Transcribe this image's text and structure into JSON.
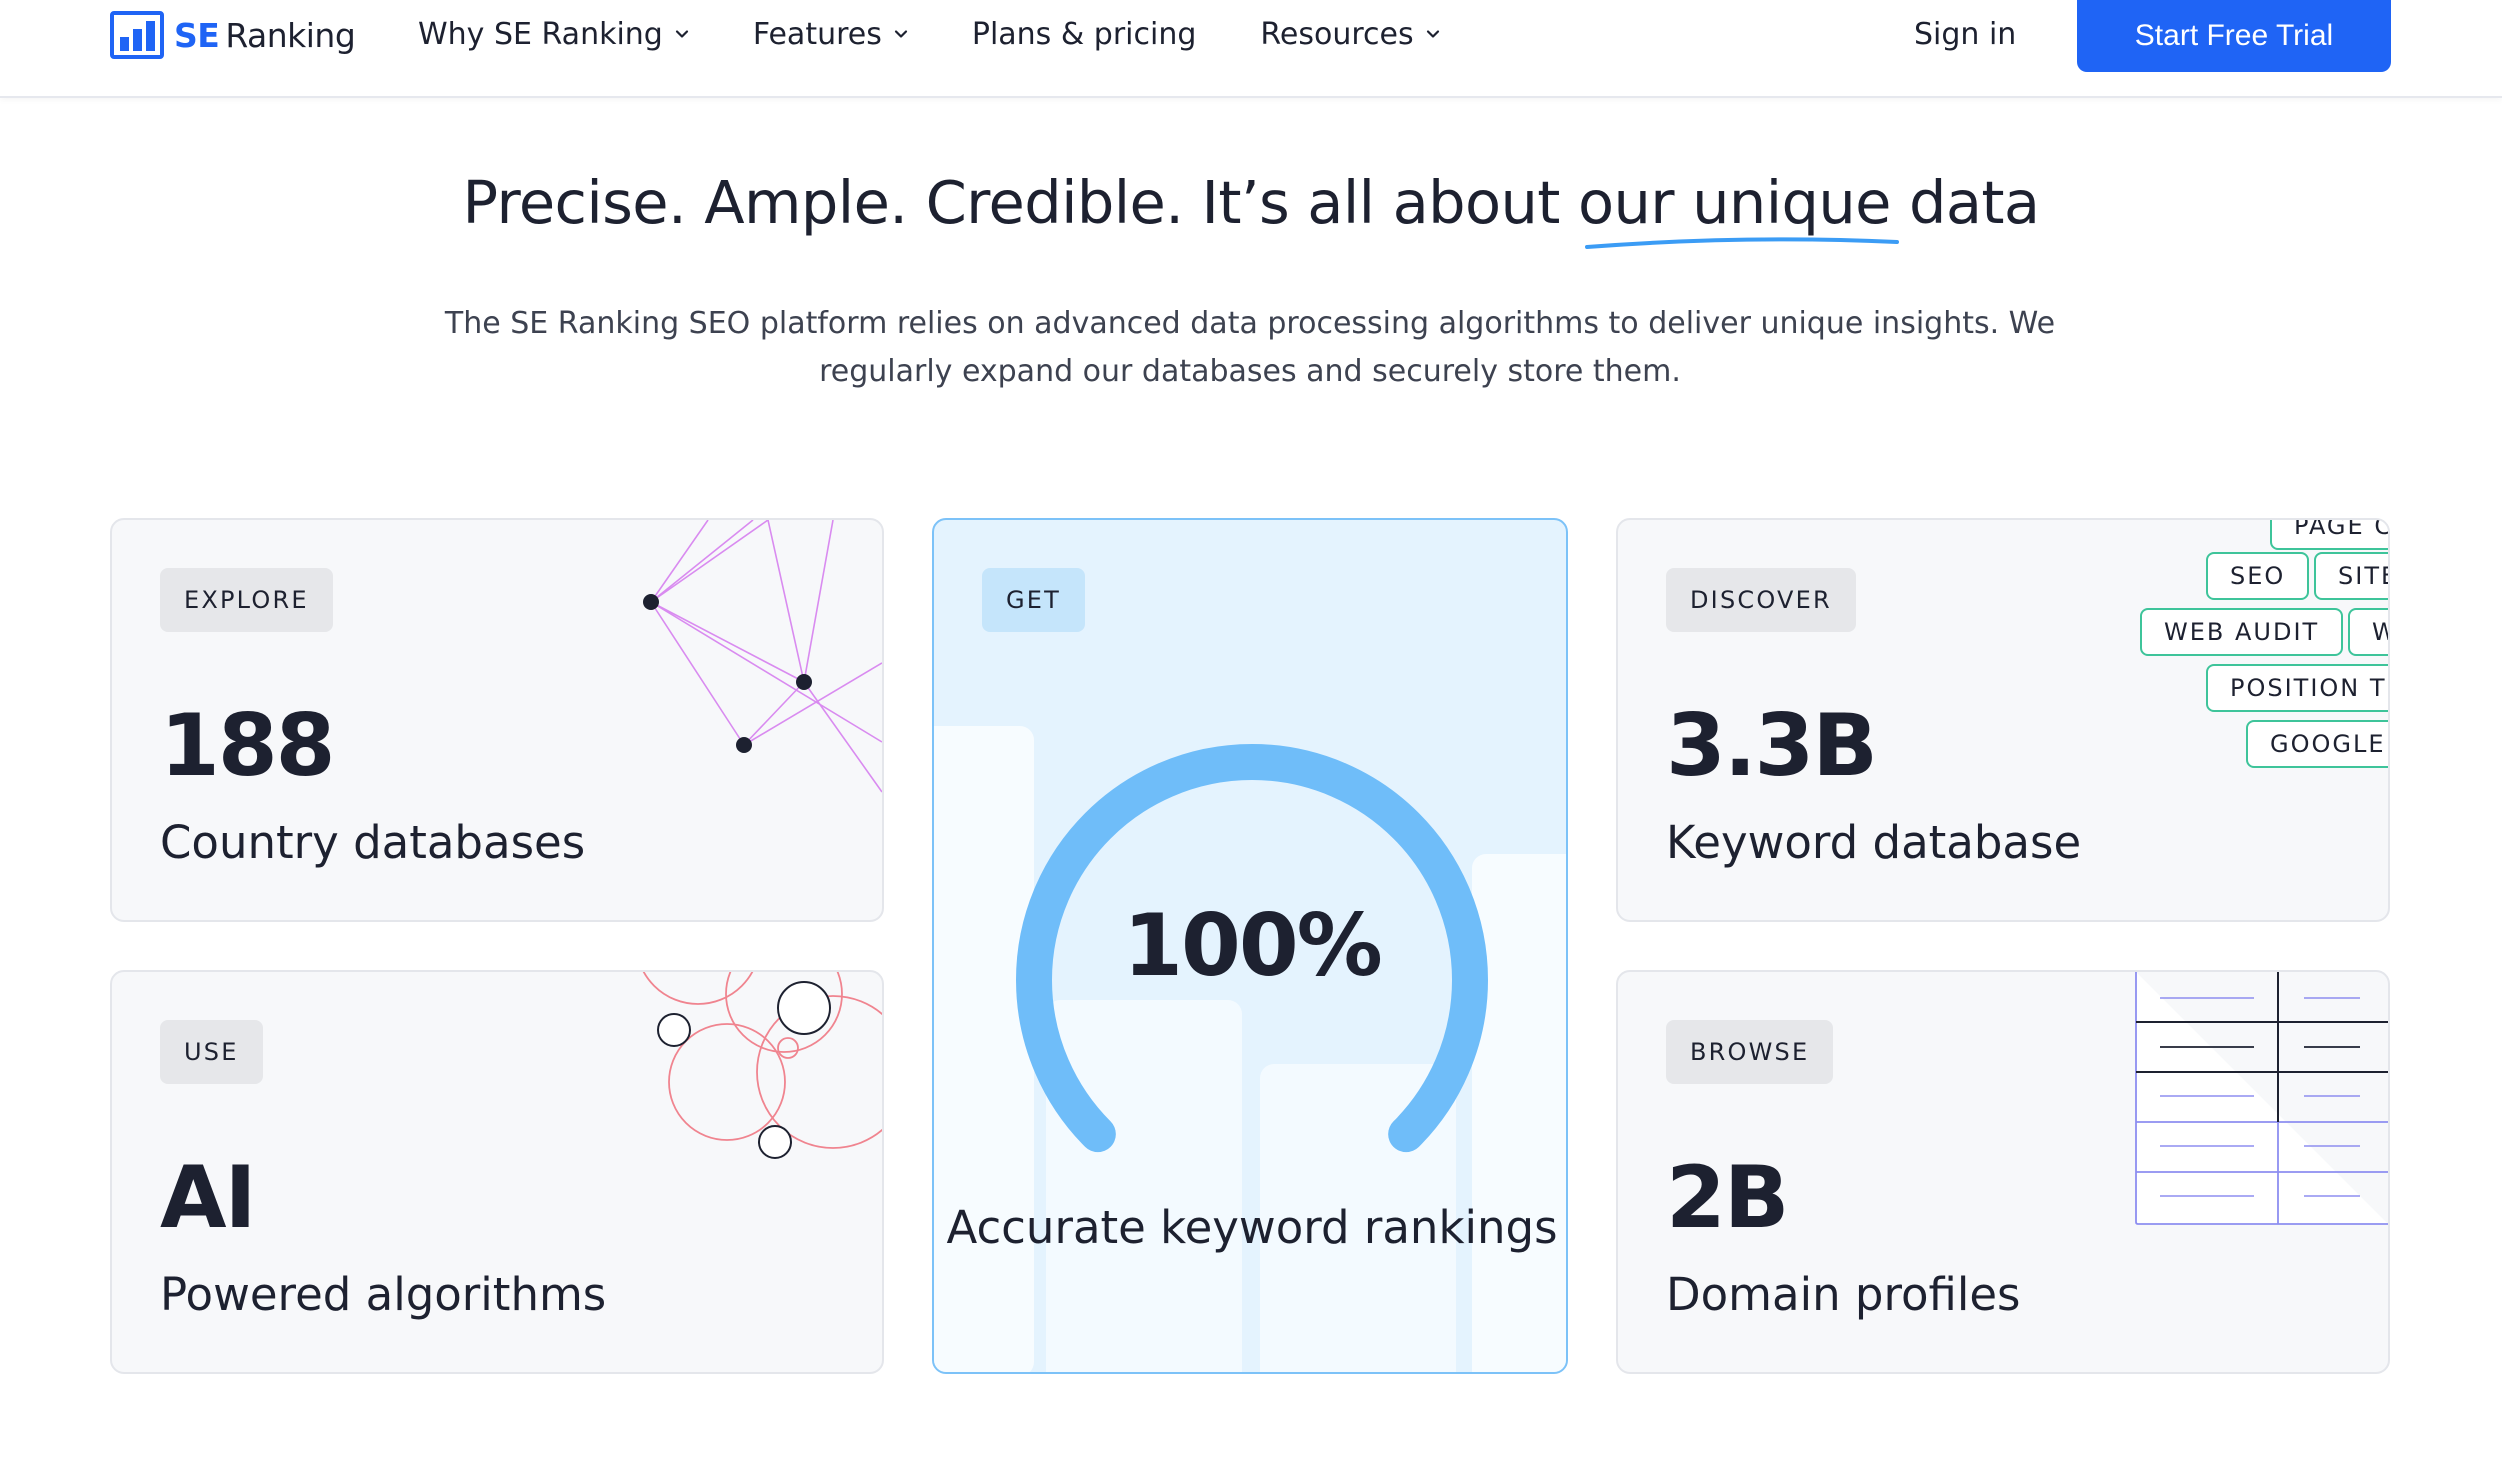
{
  "header": {
    "logo_brand": "SE",
    "logo_name": "Ranking",
    "nav": [
      {
        "label": "Why SE Ranking",
        "dropdown": true
      },
      {
        "label": "Features",
        "dropdown": true
      },
      {
        "label": "Plans & pricing",
        "dropdown": false
      },
      {
        "label": "Resources",
        "dropdown": true
      }
    ],
    "sign_in": "Sign in",
    "cta": "Start Free Trial"
  },
  "hero": {
    "title_start": "Precise. Ample. Credible. It’s all about ",
    "title_highlight": "our unique",
    "title_end": " data",
    "subtitle": "The SE Ranking SEO platform relies on advanced data processing algorithms to deliver unique insights. We regularly expand our databases and securely store them."
  },
  "cards": {
    "countries": {
      "tag": "EXPLORE",
      "value": "188",
      "label": "Country databases"
    },
    "ai": {
      "tag": "USE",
      "value": "AI",
      "label": "Powered algorithms"
    },
    "rankings": {
      "tag": "GET",
      "value": "100%",
      "label": "Accurate keyword rankings",
      "percent": 100
    },
    "keywords": {
      "tag": "DISCOVER",
      "value": "3.3B",
      "label": "Keyword database",
      "pills": [
        "PAGE C",
        "SEO",
        "SITE",
        "WEB AUDIT",
        "W",
        "POSITION TR",
        "GOOGLE"
      ]
    },
    "domains": {
      "tag": "BROWSE",
      "value": "2B",
      "label": "Domain profiles"
    }
  },
  "colors": {
    "brand": "#1f64f5",
    "gauge": "#6fbdf9",
    "pill_border": "#3ec49a",
    "network": "#d98bf0",
    "circles": "#f0848f"
  }
}
